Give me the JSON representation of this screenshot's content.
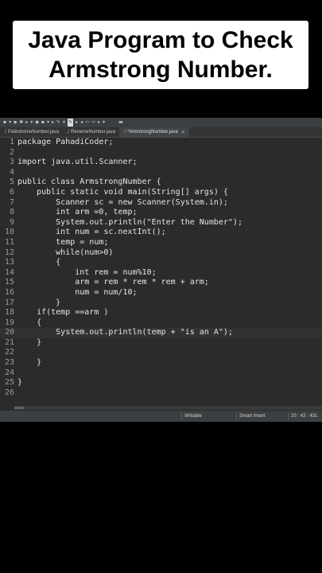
{
  "banner": {
    "line1": "Java Program to Check",
    "line2": "Armstrong Number."
  },
  "tabs": [
    {
      "label": "PalindromeNumber.java",
      "active": false
    },
    {
      "label": "ReverseNumber.java",
      "active": false
    },
    {
      "label": "*ArmstrongNumber.java",
      "active": true,
      "close": "✕"
    }
  ],
  "editor": {
    "line_numbers": [
      "1",
      "2",
      "3",
      "4",
      "5",
      "6",
      "7",
      "8",
      "9",
      "10",
      "11",
      "12",
      "13",
      "14",
      "15",
      "16",
      "17",
      "18",
      "19",
      "20",
      "21",
      "22",
      "23",
      "24",
      "25",
      "26"
    ],
    "code": [
      "package PahadiCoder;",
      "",
      "import java.util.Scanner;",
      "",
      "public class ArmstrongNumber {",
      "    public static void main(String[] args) {",
      "        Scanner sc = new Scanner(System.in);",
      "        int arm =0, temp;",
      "        System.out.println(\"Enter the Number\");",
      "        int num = sc.nextInt();",
      "        temp = num;",
      "        while(num>0)",
      "        {",
      "            int rem = num%10;",
      "            arm = rem * rem * rem + arm;",
      "            num = num/10;",
      "        }",
      "    if(temp ==arm )",
      "    {",
      "        System.out.println(temp + \"is an A\");",
      "    }",
      "",
      "    }",
      "",
      "}",
      ""
    ]
  },
  "statusbar": {
    "mode": "Writable",
    "insert": "Smart Insert",
    "position": "20 : 43 : 431"
  },
  "icons": [
    "new-icon",
    "save-icon",
    "print-icon",
    "debug-icon",
    "run-icon",
    "search-icon"
  ]
}
